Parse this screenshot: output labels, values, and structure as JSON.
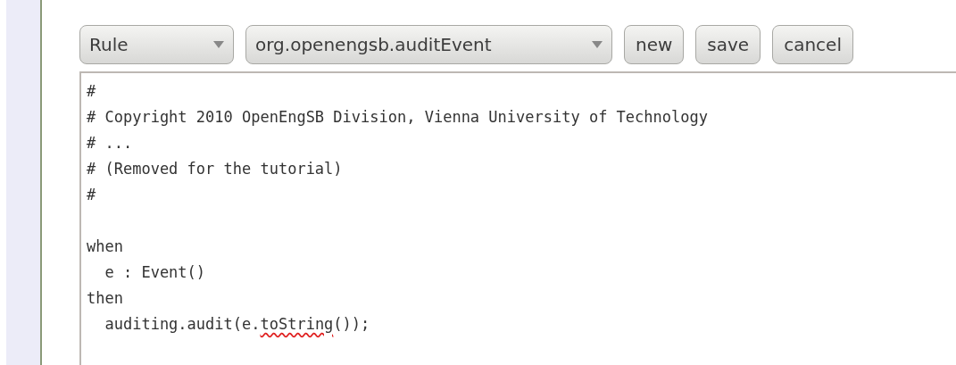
{
  "toolbar": {
    "dropdowns": [
      {
        "value": "Rule"
      },
      {
        "value": "org.openengsb.auditEvent"
      }
    ],
    "buttons": [
      "new",
      "save",
      "cancel"
    ]
  },
  "editor": {
    "lines": [
      {
        "segments": [
          {
            "text": "#",
            "misspelled": false
          }
        ]
      },
      {
        "segments": [
          {
            "text": "# Copyright 2010 OpenEngSB Division, Vienna University of Technology",
            "misspelled": false
          }
        ]
      },
      {
        "segments": [
          {
            "text": "# ...",
            "misspelled": false
          }
        ]
      },
      {
        "segments": [
          {
            "text": "# (Removed for the tutorial)",
            "misspelled": false
          }
        ]
      },
      {
        "segments": [
          {
            "text": "#",
            "misspelled": false
          }
        ]
      },
      {
        "blank_before": true,
        "segments": [
          {
            "text": "when",
            "misspelled": false
          }
        ]
      },
      {
        "segments": [
          {
            "text": "  e : Event()",
            "misspelled": false
          }
        ]
      },
      {
        "segments": [
          {
            "text": "then",
            "misspelled": false
          }
        ]
      },
      {
        "segments": [
          {
            "text": "  auditing.audit(e.",
            "misspelled": false
          },
          {
            "text": "toString",
            "misspelled": true
          },
          {
            "text": "());",
            "misspelled": false
          }
        ]
      }
    ]
  }
}
